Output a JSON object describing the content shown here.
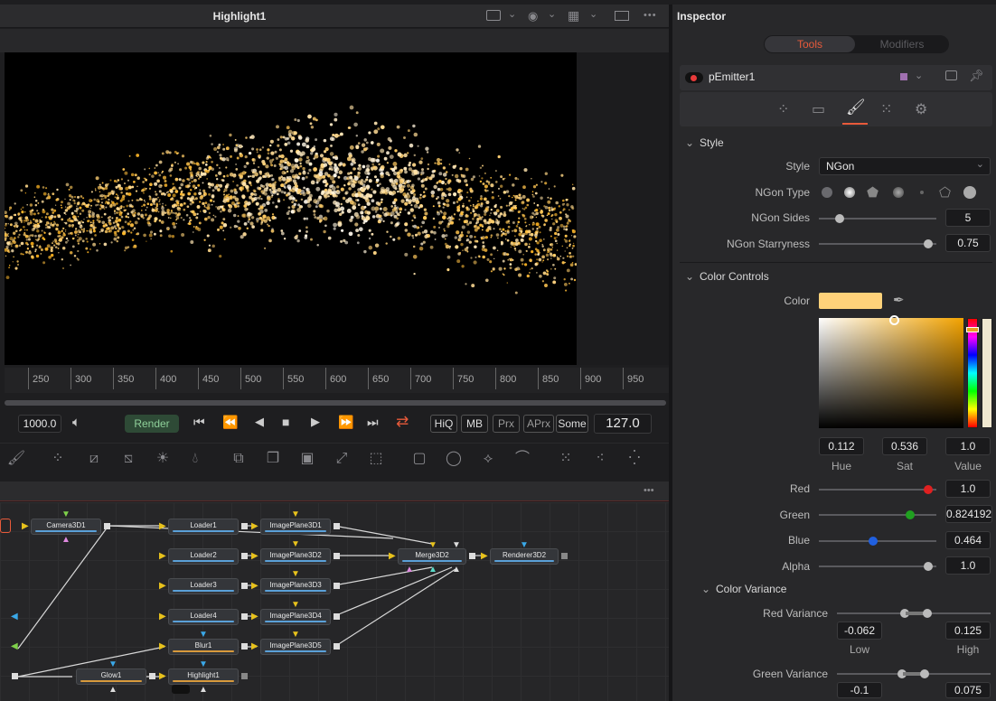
{
  "viewer": {
    "title": "Highlight1",
    "more_icon": "•••",
    "ruler_ticks": [
      "250",
      "300",
      "350",
      "400",
      "450",
      "500",
      "550",
      "600",
      "650",
      "700",
      "750",
      "800",
      "850",
      "900",
      "950"
    ]
  },
  "transport": {
    "end_frame": "1000.0",
    "render_label": "Render",
    "hiq": "HiQ",
    "mb": "MB",
    "prx": "Prx",
    "aprx": "APrx",
    "some": "Some",
    "current_frame": "127.0"
  },
  "nodes": {
    "camera": "Camera3D1",
    "loader1": "Loader1",
    "loader2": "Loader2",
    "loader3": "Loader3",
    "loader4": "Loader4",
    "blur": "Blur1",
    "glow": "Glow1",
    "highlight": "Highlight1",
    "ip1": "ImagePlane3D1",
    "ip2": "ImagePlane3D2",
    "ip3": "ImagePlane3D3",
    "ip4": "ImagePlane3D4",
    "ip5": "ImagePlane3D5",
    "merge": "Merge3D2",
    "renderer": "Renderer3D2"
  },
  "inspector": {
    "title": "Inspector",
    "tab_tools": "Tools",
    "tab_modifiers": "Modifiers",
    "tool_name": "pEmitter1",
    "style_section": "Style",
    "style_label": "Style",
    "style_value": "NGon",
    "ngon_type_label": "NGon Type",
    "ngon_sides_label": "NGon Sides",
    "ngon_sides_value": "5",
    "ngon_sides_fraction": 0.15,
    "ngon_star_label": "NGon Starryness",
    "ngon_star_value": "0.75",
    "ngon_star_fraction": 0.97,
    "color_section": "Color Controls",
    "color_label": "Color",
    "color_hex": "#ffd27a",
    "hue_value": "0.112",
    "sat_value": "0.536",
    "val_value": "1.0",
    "hue_label": "Hue",
    "sat_label": "Sat",
    "val_label": "Value",
    "red_label": "Red",
    "red_value": "1.0",
    "red_fraction": 0.97,
    "green_label": "Green",
    "green_value": "0.824192",
    "green_fraction": 0.8,
    "blue_label": "Blue",
    "blue_value": "0.464",
    "blue_fraction": 0.46,
    "alpha_label": "Alpha",
    "alpha_value": "1.0",
    "alpha_fraction": 0.97,
    "variance_section": "Color Variance",
    "red_var_label": "Red Variance",
    "red_var_low": "-0.062",
    "red_var_high": "0.125",
    "low_label": "Low",
    "high_label": "High",
    "green_var_label": "Green Variance",
    "green_var_low": "-0.1",
    "green_var_high": "0.075"
  },
  "colors": {
    "accent_red": "#e85a3a",
    "panel": "#2c2c2e"
  }
}
